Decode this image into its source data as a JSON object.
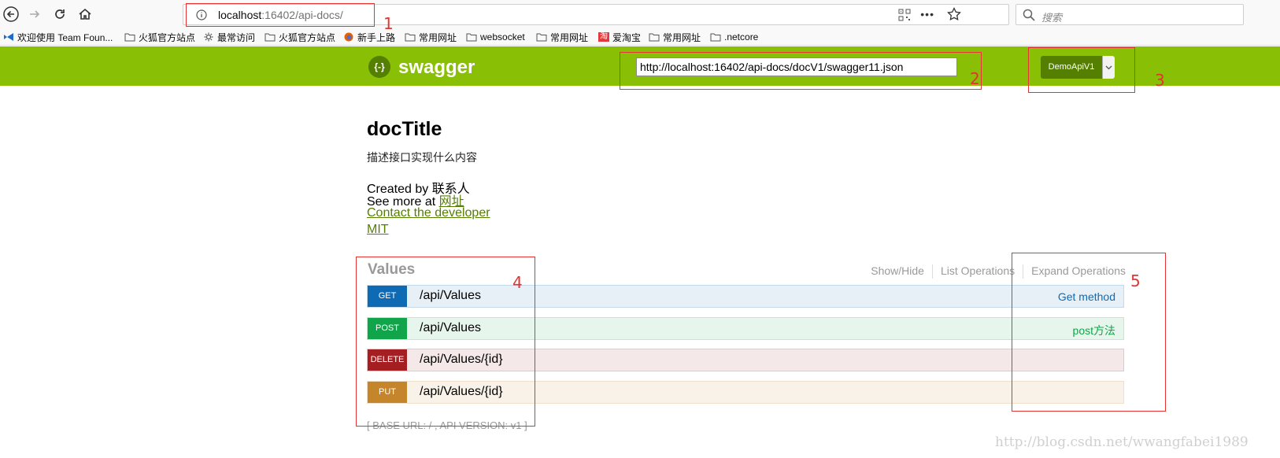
{
  "browser": {
    "url_host": "localhost",
    "url_rest": ":16402/api-docs/",
    "search_placeholder": "搜索",
    "more_glyph": "•••"
  },
  "bookmarks": [
    {
      "label": "欢迎使用 Team Foun...",
      "icon": "vs-icon"
    },
    {
      "label": "火狐官方站点",
      "icon": "folder-icon"
    },
    {
      "label": "最常访问",
      "icon": "gear-icon"
    },
    {
      "label": "火狐官方站点",
      "icon": "folder-icon"
    },
    {
      "label": "新手上路",
      "icon": "firefox-icon"
    },
    {
      "label": "常用网址",
      "icon": "folder-icon"
    },
    {
      "label": "websocket",
      "icon": "folder-icon"
    },
    {
      "label": "常用网址",
      "icon": "folder-icon"
    },
    {
      "label": "爱淘宝",
      "icon": "taobao-icon",
      "icon_text": "淘"
    },
    {
      "label": "常用网址",
      "icon": "folder-icon"
    },
    {
      "label": ".netcore",
      "icon": "folder-icon"
    }
  ],
  "swagger": {
    "logo_icon_text": "{-}",
    "logo_text": "swagger",
    "spec_url": "http://localhost:16402/api-docs/docV1/swagger11.json",
    "api_version_select": "DemoApiV1"
  },
  "info": {
    "title": "docTitle",
    "description": "描述接口实现什么内容",
    "created_by": "Created by 联系人",
    "see_more_prefix": "See more at ",
    "see_more_link": "网址",
    "contact": "Contact the developer",
    "license": "MIT"
  },
  "resource": {
    "name": "Values",
    "actions": [
      "Show/Hide",
      "List Operations",
      "Expand Operations"
    ],
    "operations": [
      {
        "method": "GET",
        "path": "/api/Values",
        "summary": "Get method"
      },
      {
        "method": "POST",
        "path": "/api/Values",
        "summary": "post方法"
      },
      {
        "method": "DELETE",
        "path": "/api/Values/{id}",
        "summary": ""
      },
      {
        "method": "PUT",
        "path": "/api/Values/{id}",
        "summary": ""
      }
    ]
  },
  "footer": {
    "base_url": "[ BASE URL: / , API VERSION: v1 ]"
  },
  "annotations": [
    "1",
    "2",
    "3",
    "4",
    "5"
  ],
  "watermark": "http://blog.csdn.net/wwangfabei1989",
  "colors": {
    "swagger_green": "#89bf04",
    "get": "#0f6ab4",
    "post": "#10a54a",
    "delete": "#a41e22",
    "put": "#c5862b",
    "annotation_red": "#e53333"
  }
}
